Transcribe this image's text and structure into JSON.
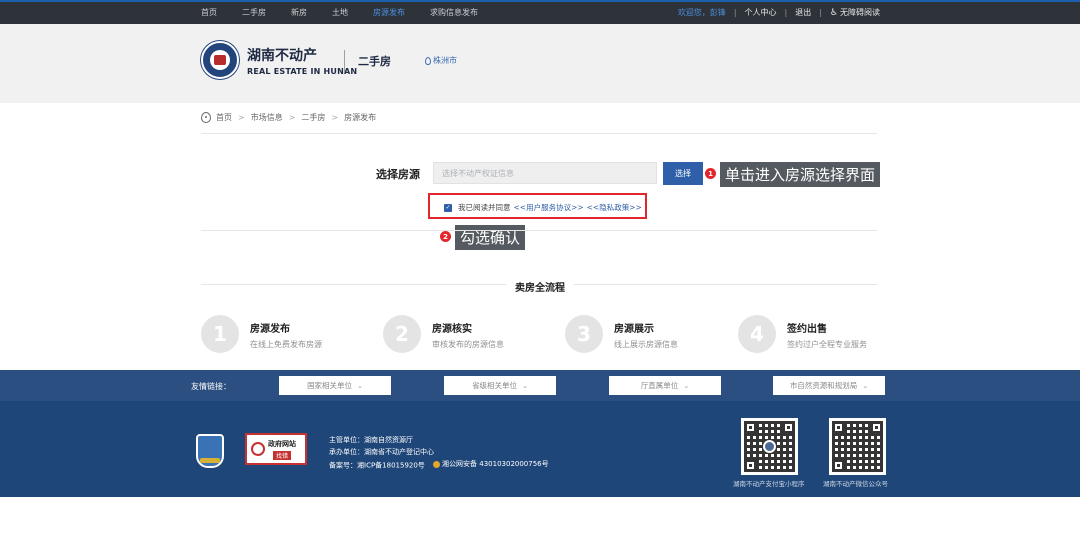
{
  "topnav": {
    "items": [
      "首页",
      "二手房",
      "新房",
      "土地",
      "房源发布",
      "求购信息发布"
    ],
    "active_index": 4,
    "welcome": "欢迎您，彭锋",
    "user_center": "个人中心",
    "logout": "退出",
    "accessibility": "无障碍阅读",
    "separator": "|"
  },
  "header": {
    "logo_cn": "湖南不动产",
    "logo_en": "REAL ESTATE IN HUNAN",
    "section": "二手房",
    "city": "株洲市"
  },
  "breadcrumb": [
    "首页",
    "市场信息",
    "二手房",
    "房源发布"
  ],
  "select": {
    "label": "选择房源",
    "placeholder": "选择不动产权证信息",
    "button": "选择"
  },
  "callouts": [
    {
      "num": "1",
      "text": "单击进入房源选择界面"
    },
    {
      "num": "2",
      "text": "勾选确认"
    }
  ],
  "agreement": {
    "checked": true,
    "text": "我已阅读并同意",
    "link1": "<<用户服务协议>>",
    "link2": "<<隐私政策>>"
  },
  "process": {
    "title": "卖房全流程",
    "steps": [
      {
        "num": "1",
        "name": "房源发布",
        "desc": "在线上免费发布房源"
      },
      {
        "num": "2",
        "name": "房源核实",
        "desc": "审核发布的房源信息"
      },
      {
        "num": "3",
        "name": "房源展示",
        "desc": "线上展示房源信息"
      },
      {
        "num": "4",
        "name": "签约出售",
        "desc": "签约过户全程专业服务"
      }
    ]
  },
  "links": {
    "label": "友情链接：",
    "dropdowns": [
      "国家相关单位",
      "省级相关单位",
      "厅直属单位",
      "市自然资源和规划局"
    ]
  },
  "footer": {
    "sponsor": "主管单位：湖南自然资源厅",
    "organizer": "承办单位：湖南省不动产登记中心",
    "icp": "备案号：湘ICP备18015920号",
    "police": "湘公网安备 43010302000756号",
    "gov_badge_line1": "政府网站",
    "gov_badge_line2": "找错",
    "badge_shield_text": "党政机关",
    "qr1_caption": "湖南不动产支付宝小程序",
    "qr2_caption": "湖南不动产微信公众号"
  },
  "colors": {
    "primary": "#2f5fa8",
    "topbar": "#2e333a",
    "footer": "#1f4678",
    "linkbar": "#2c4f82",
    "highlight": "#e3262c"
  }
}
